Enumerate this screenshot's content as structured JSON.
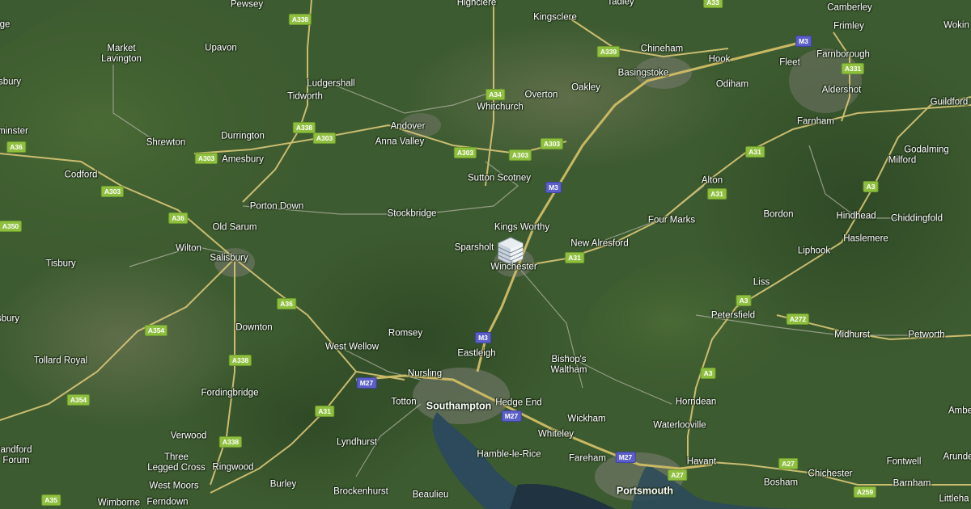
{
  "map": {
    "type": "satellite",
    "colors": {
      "land": "#3b5a2e",
      "water": "#2c4a5c",
      "road": "#d9c777",
      "minor_road": "#a9ad9b",
      "a_shield": "#8fbf3f",
      "m_shield": "#5b5fc7"
    },
    "marker": {
      "icon": "building-marker-icon",
      "near": "Winchester"
    }
  },
  "places": {
    "pewsey": "Pewsey",
    "highclere": "Highclere",
    "tadley": "Tadley",
    "kingsclere": "Kingsclere",
    "camberley": "Camberley",
    "frimley": "Frimley",
    "woking": "Woking",
    "market_lavington": "Market\nLavington",
    "upavon": "Upavon",
    "chineham": "Chineham",
    "hook": "Hook",
    "fleet": "Fleet",
    "farnborough": "Farnborough",
    "basingstoke": "Basingstoke",
    "ludgershall": "Ludgershall",
    "oakley": "Oakley",
    "odiham": "Odiham",
    "aldershot": "Aldershot",
    "tidworth": "Tidworth",
    "overton": "Overton",
    "whitchurch": "Whitchurch",
    "guildford": "Guildford",
    "durrington": "Durrington",
    "andover": "Andover",
    "farnham": "Farnham",
    "shrewton": "Shrewton",
    "anna_valley": "Anna Valley",
    "godalming": "Godalming",
    "amesbury": "Amesbury",
    "milford": "Milford",
    "codford": "Codford",
    "sutton_scotney": "Sutton Scotney",
    "alton": "Alton",
    "porton_down": "Porton Down",
    "stockbridge": "Stockbridge",
    "bordon": "Bordon",
    "hindhead": "Hindhead",
    "chiddingfold": "Chiddingfold",
    "kings_worthy": "Kings Worthy",
    "four_marks": "Four Marks",
    "old_sarum": "Old Sarum",
    "haslemere": "Haslemere",
    "new_alresford": "New Alresford",
    "sparsholt": "Sparsholt",
    "wilton": "Wilton",
    "liphook": "Liphook",
    "salisbury": "Salisbury",
    "tisbury": "Tisbury",
    "winchester": "Winchester",
    "liss": "Liss",
    "petersfield": "Petersfield",
    "downton": "Downton",
    "romsey": "Romsey",
    "midhurst": "Midhurst",
    "petworth": "Petworth",
    "west_wellow": "West Wellow",
    "tollard_royal": "Tollard Royal",
    "eastleigh": "Eastleigh",
    "bishops_waltham": "Bishop's\nWaltham",
    "nursling": "Nursling",
    "fordingbridge": "Fordingbridge",
    "totton": "Totton",
    "southampton": "Southampton",
    "hedge_end": "Hedge End",
    "horndean": "Horndean",
    "verwood": "Verwood",
    "wickham": "Wickham",
    "waterlooville": "Waterlooville",
    "whiteley": "Whiteley",
    "lyndhurst": "Lyndhurst",
    "three_legged_cross": "Three\nLegged Cross",
    "ringwood": "Ringwood",
    "hamble_le_rice": "Hamble-le-Rice",
    "fareham": "Fareham",
    "havant": "Havant",
    "chichester": "Chichester",
    "fontwell": "Fontwell",
    "west_moors": "West Moors",
    "burley": "Burley",
    "brockenhurst": "Brockenhurst",
    "beaulieu": "Beaulieu",
    "portsmouth": "Portsmouth",
    "bosham": "Bosham",
    "barnham": "Barnham",
    "wimborne": "Wimborne",
    "ferndown": "Ferndown",
    "edge_ge": "ge",
    "edge_sbury": "sbury",
    "edge_minster": "minster",
    "edge_sbury2": "sbury",
    "edge_andford": "andford\nForum",
    "edge_wokin": "Wokin",
    "edge_ambe": "Ambe",
    "edge_arunde": "Arunde",
    "edge_littleha": "Littleha"
  },
  "shields": {
    "a338_n": "A338",
    "a339": "A339",
    "a33": "A33",
    "a34": "A34",
    "a338_t": "A338",
    "a303_w": "A303",
    "a303_a": "A303",
    "a303_b": "A303",
    "a303_c": "A303",
    "a303_d": "A303",
    "a36_n": "A36",
    "a36_w": "A36",
    "a303_co": "A303",
    "a350": "A350",
    "a36_s": "A36",
    "a354_a": "A354",
    "a354_b": "A354",
    "a338_s": "A338",
    "a338_r": "A338",
    "a31_w": "A31",
    "a31_m": "A31",
    "a31_al": "A31",
    "a31_f": "A31",
    "a331": "A331",
    "a3_a": "A3",
    "a3_b": "A3",
    "a3_c": "A3",
    "a272": "A272",
    "a27_w": "A27",
    "a27_e": "A27",
    "a259": "A259",
    "a35_e": "A35",
    "m3_n": "M3",
    "m3_m": "M3",
    "m3_s": "M3",
    "m27_w": "M27",
    "m27_m": "M27",
    "m27_e": "M27"
  }
}
